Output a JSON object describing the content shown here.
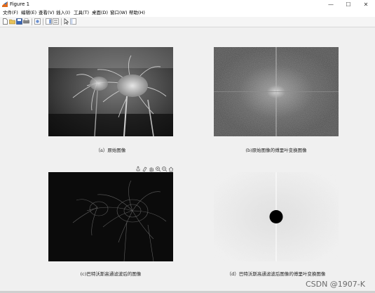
{
  "window": {
    "title": "Figure 1",
    "minimize": "—",
    "maximize": "☐",
    "close": "✕"
  },
  "menu": {
    "items": [
      "文件(F)",
      "编辑(E)",
      "查看(V)",
      "插入(I)",
      "工具(T)",
      "桌面(D)",
      "窗口(W)",
      "帮助(H)"
    ]
  },
  "toolbar": {
    "icons": [
      "new-figure-icon",
      "open-file-icon",
      "save-icon",
      "print-icon",
      "link-plot-icon",
      "insert-colorbar-icon",
      "insert-legend-icon",
      "pointer-icon",
      "property-inspector-icon"
    ]
  },
  "axes_toolbar": {
    "icons": [
      "export-icon",
      "brush-icon",
      "pan-icon",
      "zoom-in-icon",
      "zoom-out-icon",
      "home-icon"
    ]
  },
  "panels": {
    "a": {
      "caption": "（a）原始图像"
    },
    "b": {
      "caption": "(b)原始图像的傅里叶变换图像"
    },
    "c": {
      "caption": "(c)巴特沃斯高通滤波后的图像"
    },
    "d": {
      "caption": "（d）巴特沃斯高通滤波后图像的傅里叶变换图像"
    }
  },
  "watermark": "CSDN @1907-K",
  "colors": {
    "background": "#f0f0f0",
    "image_dark": "#0b0b0b",
    "spectrum_gray": "#5a5a5a",
    "filtered_spectrum_light": "#ececec"
  }
}
